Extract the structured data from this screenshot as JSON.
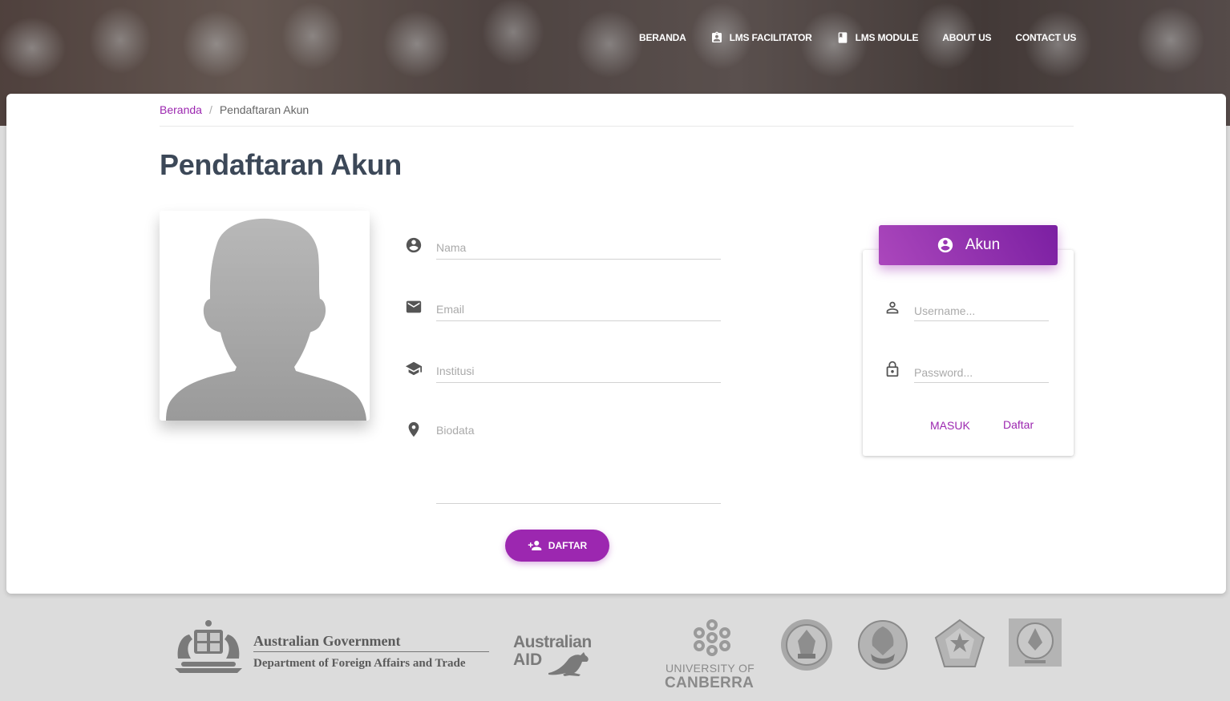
{
  "nav": {
    "items": [
      {
        "label": "BERANDA",
        "icon": ""
      },
      {
        "label": "LMS FACILITATOR",
        "icon": "assignment-ind-icon"
      },
      {
        "label": "LMS MODULE",
        "icon": "book-icon"
      },
      {
        "label": "ABOUT US",
        "icon": ""
      },
      {
        "label": "CONTACT US",
        "icon": ""
      }
    ]
  },
  "breadcrumb": {
    "home": "Beranda",
    "separator": "/",
    "current": "Pendaftaran Akun"
  },
  "page": {
    "title": "Pendaftaran Akun"
  },
  "form": {
    "nama_placeholder": "Nama",
    "email_placeholder": "Email",
    "institusi_placeholder": "Institusi",
    "biodata_placeholder": "Biodata",
    "submit_label": "DAFTAR"
  },
  "login": {
    "header": "Akun",
    "username_placeholder": "Username...",
    "password_placeholder": "Password...",
    "masuk_label": "MASUK",
    "daftar_label": "Daftar"
  },
  "footer": {
    "aus_gov_line1": "Australian Government",
    "aus_gov_line2": "Department of Foreign Affairs and Trade",
    "aus_aid_line1": "Australian",
    "aus_aid_line2": "AID",
    "canberra_line1": "UNIVERSITY OF",
    "canberra_line2": "CANBERRA"
  },
  "colors": {
    "accent": "#9c27b0",
    "title": "#3c4858"
  }
}
